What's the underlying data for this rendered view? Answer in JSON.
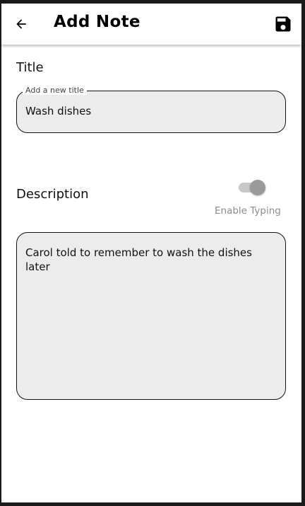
{
  "app_bar": {
    "title": "Add Note",
    "back_icon": "arrow-left-icon",
    "save_icon": "floppy-disk-icon"
  },
  "title_section": {
    "label": "Title",
    "field_label": "Add a new title",
    "value": "Wash dishes"
  },
  "description_section": {
    "label": "Description",
    "toggle_caption": "Enable Typing",
    "toggle_state": "on-disabled",
    "value": "Carol told to remember to wash the dishes later"
  }
}
